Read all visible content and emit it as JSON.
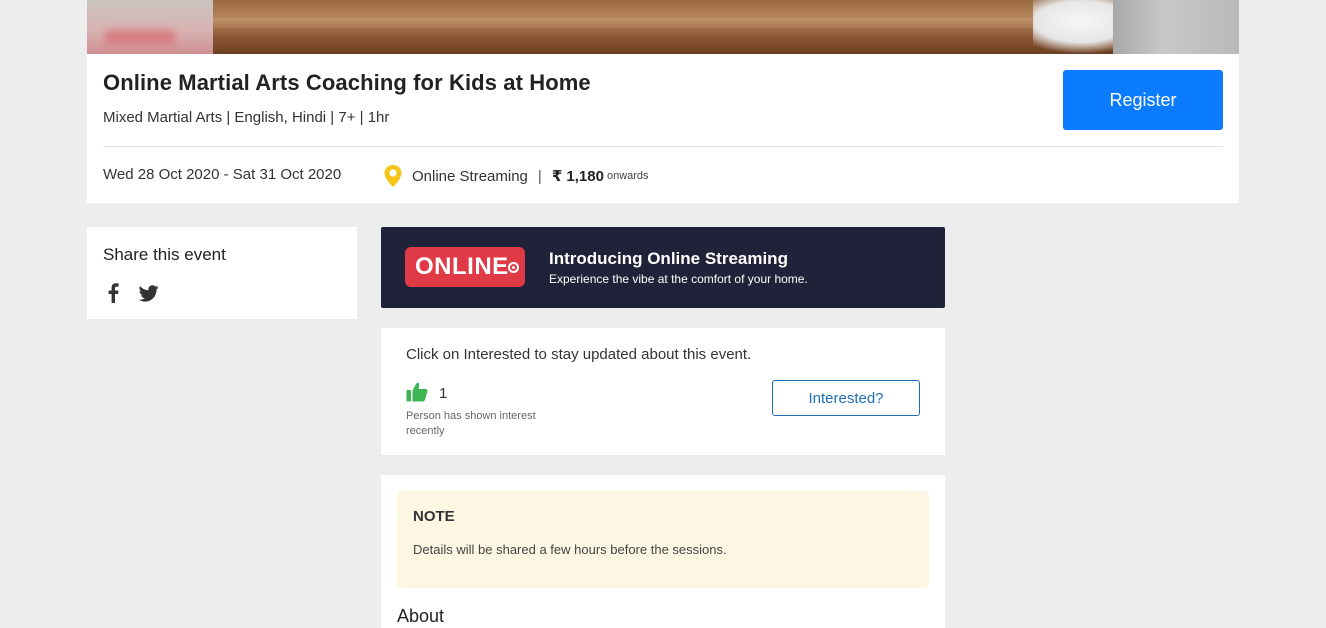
{
  "event": {
    "title": "Online Martial Arts Coaching for Kids at Home",
    "meta": "Mixed Martial Arts | English, Hindi | 7+ | 1hr",
    "register_label": "Register",
    "date_range": "Wed 28 Oct 2020 - Sat 31 Oct 2020",
    "venue": "Online Streaming",
    "separator": "|",
    "price": "₹ 1,180",
    "price_suffix": "onwards"
  },
  "share": {
    "title": "Share this event",
    "icons": [
      "facebook-icon",
      "twitter-icon"
    ]
  },
  "online_banner": {
    "badge": "ONLINE",
    "heading": "Introducing Online Streaming",
    "subheading": "Experience the vibe at the comfort of your home."
  },
  "interest": {
    "prompt": "Click on Interested to stay updated about this event.",
    "count": "1",
    "caption": "Person has shown interest recently",
    "button_label": "Interested?"
  },
  "note": {
    "title": "NOTE",
    "text": "Details will be shared a few hours before the sessions."
  },
  "about": {
    "title": "About"
  },
  "colors": {
    "primary": "#0b7cff",
    "online_card_bg": "#1f2238",
    "online_badge": "#e03a47",
    "thumb_green": "#3cb552",
    "pin_yellow": "#f5c518",
    "note_bg": "#fdf6e2"
  }
}
